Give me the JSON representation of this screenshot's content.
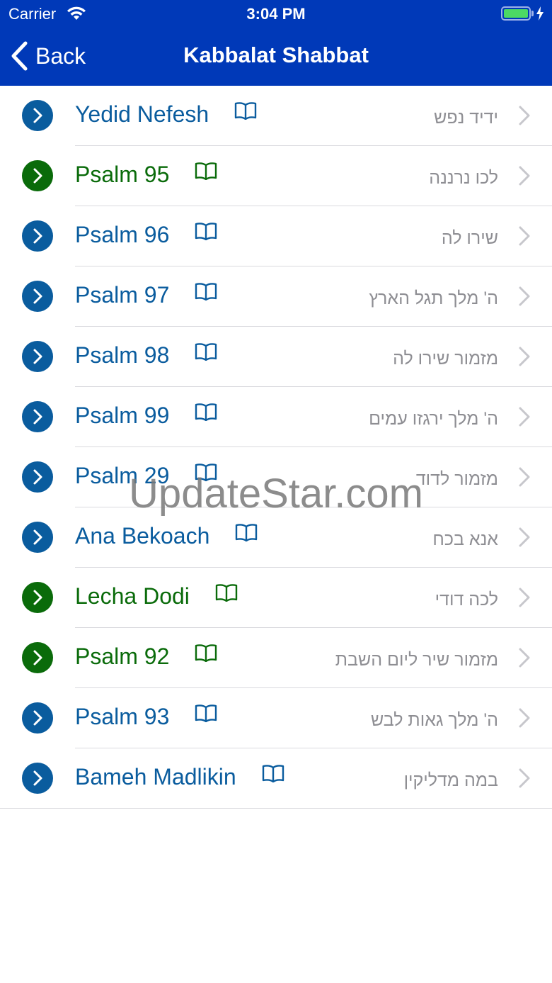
{
  "status_bar": {
    "carrier": "Carrier",
    "time": "3:04 PM"
  },
  "nav": {
    "back_label": "Back",
    "title": "Kabbalat Shabbat"
  },
  "colors": {
    "bar": "#0039b8",
    "blue": "#0a5c9e",
    "green": "#0a6b0a"
  },
  "items": [
    {
      "name": "Yedid Nefesh",
      "hebrew": "ידיד נפש",
      "color": "blue"
    },
    {
      "name": "Psalm 95",
      "hebrew": "לכו נרננה",
      "color": "green"
    },
    {
      "name": "Psalm 96",
      "hebrew": "שירו לה",
      "color": "blue"
    },
    {
      "name": "Psalm 97",
      "hebrew": "ה' מלך תגל הארץ",
      "color": "blue"
    },
    {
      "name": "Psalm 98",
      "hebrew": "מזמור שירו לה",
      "color": "blue"
    },
    {
      "name": "Psalm 99",
      "hebrew": "ה' מלך ירגזו עמים",
      "color": "blue"
    },
    {
      "name": "Psalm 29",
      "hebrew": "מזמור לדוד",
      "color": "blue"
    },
    {
      "name": "Ana Bekoach",
      "hebrew": "אנא בכח",
      "color": "blue"
    },
    {
      "name": "Lecha Dodi",
      "hebrew": "לכה דודי",
      "color": "green"
    },
    {
      "name": "Psalm 92",
      "hebrew": "מזמור שיר ליום השבת",
      "color": "green"
    },
    {
      "name": "Psalm 93",
      "hebrew": "ה' מלך גאות לבש",
      "color": "blue"
    },
    {
      "name": "Bameh Madlikin",
      "hebrew": "במה מדליקין",
      "color": "blue"
    }
  ],
  "watermark": "UpdateStar.com"
}
